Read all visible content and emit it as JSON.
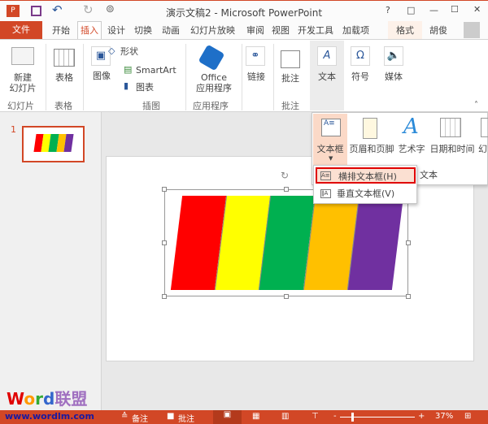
{
  "title": "演示文稿2 - Microsoft PowerPoint",
  "window_buttons": [
    "?",
    "□",
    "—",
    "☐",
    "✕"
  ],
  "tabs": {
    "file": "文件",
    "items": [
      "开始",
      "插入",
      "设计",
      "切换",
      "动画",
      "幻灯片放映",
      "审阅",
      "视图",
      "开发工具",
      "加载项",
      "格式"
    ],
    "user": "胡俊"
  },
  "ribbon": {
    "new_slide": "新建\n幻灯片",
    "table": "表格",
    "image": "图像",
    "shapes": "形状",
    "smartart": "SmartArt",
    "chart": "图表",
    "office_apps_1": "Office",
    "office_apps_2": "应用程序",
    "link": "链接",
    "comment": "批注",
    "text": "文本",
    "symbol": "符号",
    "media": "媒体",
    "groups": {
      "slides": "幻灯片",
      "tables": "表格",
      "illustrations": "插图",
      "apps": "应用程序",
      "comments": "批注"
    }
  },
  "gallery": {
    "textbox": "文本框",
    "header_footer": "页眉和页脚",
    "wordart": "艺术字",
    "datetime": "日期和时间",
    "slide_no": "幻",
    "group": "文本"
  },
  "menu": {
    "horizontal": "横排文本框(H)",
    "vertical": "垂直文本框(V)"
  },
  "slides": {
    "number": "1"
  },
  "stripe_colors": [
    "#ff0000",
    "#ffff00",
    "#00b050",
    "#ffc000",
    "#7030a0"
  ],
  "status": {
    "notes": "备注",
    "comments": "批注",
    "zoom": "37%",
    "zoom_percent": 37
  },
  "watermark": {
    "logo": "Word联盟",
    "url": "www.wordlm.com"
  }
}
